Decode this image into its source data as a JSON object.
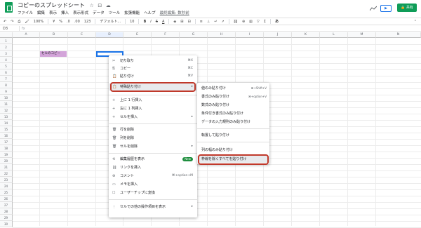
{
  "header": {
    "title": "コピーのスプレッドシート",
    "star_icon": "☆",
    "folder_icon": "⊡",
    "cloud_icon": "☁",
    "menus": [
      "ファイル",
      "編集",
      "表示",
      "挿入",
      "表示形式",
      "データ",
      "ツール",
      "拡張機能",
      "ヘルプ"
    ],
    "last_edit": "最終編集: 数秒前",
    "present_label": "▶",
    "share_label": "🔒 共有"
  },
  "toolbar": {
    "undo": "↶",
    "redo": "↷",
    "print": "⎙",
    "paint": "🖌",
    "zoom": "100%",
    "currency": "¥",
    "percent": "%",
    "dec_less": ".0",
    "dec_more": ".00",
    "format": "123",
    "font": "デフォルト...",
    "size": "10",
    "bold": "B",
    "italic": "I",
    "strike": "S",
    "color": "A",
    "fill": "◈",
    "borders": "⊞",
    "merge": "⊟",
    "align": "≡",
    "valign": "⊥",
    "wrap": "↵",
    "rotate": "↗",
    "link": "⛓",
    "comment": "⊕",
    "chart": "▥",
    "filter": "▽",
    "functions": "Σ",
    "input": "あ",
    "collapse": "⌃"
  },
  "formula_bar": {
    "name_box": "D3",
    "fx": "fx"
  },
  "grid": {
    "columns": [
      "A",
      "B",
      "C",
      "D",
      "E",
      "F",
      "G",
      "H",
      "I",
      "J",
      "K",
      "L",
      "M",
      "N"
    ],
    "rows": [
      "1",
      "2",
      "3",
      "4",
      "5",
      "6",
      "7",
      "8",
      "9",
      "10",
      "11",
      "12",
      "13",
      "14",
      "15",
      "16",
      "17",
      "18",
      "19",
      "20",
      "21",
      "22",
      "23",
      "24",
      "25",
      "26",
      "27",
      "28",
      "29",
      "30"
    ],
    "cell_b3": "セルのコピー"
  },
  "context_menu": {
    "items": [
      {
        "icon": "✂",
        "label": "切り取り",
        "shortcut": "⌘X"
      },
      {
        "icon": "⎘",
        "label": "コピー",
        "shortcut": "⌘C"
      },
      {
        "icon": "📋",
        "label": "貼り付け",
        "shortcut": "⌘V"
      },
      {
        "icon": "📋",
        "label": "特殊貼り付け",
        "shortcut": "▸"
      },
      {
        "icon": "+",
        "label": "上に 1 行挿入",
        "shortcut": ""
      },
      {
        "icon": "+",
        "label": "左に 1 列挿入",
        "shortcut": ""
      },
      {
        "icon": "+",
        "label": "セルを挿入",
        "shortcut": "▸"
      },
      {
        "icon": "🗑",
        "label": "行を削除",
        "shortcut": ""
      },
      {
        "icon": "🗑",
        "label": "列を削除",
        "shortcut": ""
      },
      {
        "icon": "🗑",
        "label": "セルを削除",
        "shortcut": "▸"
      },
      {
        "icon": "⟲",
        "label": "編集履歴を表示",
        "shortcut": "",
        "badge": "New"
      },
      {
        "icon": "⛓",
        "label": "リンクを挿入",
        "shortcut": ""
      },
      {
        "icon": "⊕",
        "label": "コメント",
        "shortcut": "⌘+option+M"
      },
      {
        "icon": "▭",
        "label": "メモを挿入",
        "shortcut": ""
      },
      {
        "icon": "☐",
        "label": "ユーザーチップに変換",
        "shortcut": ""
      },
      {
        "icon": "⋮",
        "label": "セルでの他の操作項目を表示",
        "shortcut": "▸"
      }
    ]
  },
  "submenu": {
    "items": [
      {
        "label": "値のみ貼り付け",
        "shortcut": "⌘+Shift+V"
      },
      {
        "label": "書式のみ貼り付け",
        "shortcut": "⌘+option+V"
      },
      {
        "label": "数式のみ貼り付け",
        "shortcut": ""
      },
      {
        "label": "条件付き書式のみ貼り付け",
        "shortcut": ""
      },
      {
        "label": "データの入力規則のみ貼り付け",
        "shortcut": ""
      },
      {
        "label": "転置して貼り付け",
        "shortcut": ""
      },
      {
        "label": "列の幅のみ貼り付け",
        "shortcut": ""
      },
      {
        "label": "枠線を除くすべてを貼り付け",
        "shortcut": ""
      }
    ]
  },
  "colors": {
    "accent": "#1a73e8",
    "share": "#0f9d58",
    "highlight_outline": "#c0392b",
    "cell_fill": "#d3a4d9"
  }
}
